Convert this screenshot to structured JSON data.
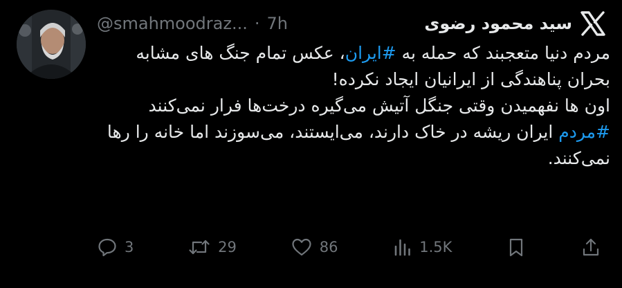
{
  "author": {
    "display_name": "سید محمود رضوی",
    "handle": "@smahmoodraz...",
    "separator": "·",
    "time": "7h"
  },
  "tweet": {
    "line1_pre": "مردم دنیا متعجبند که حمله به ",
    "hashtag1": "#ایران",
    "line1_post": "، عکس تمام جنگ های مشابه بحران پناهندگی از ایرانیان ایجاد نکرده!",
    "para2": "اون ها نفهمیدن وقتی جنگل آتیش می‌گیره درخت‌ها فرار نمی‌کنند",
    "hashtag2": "#مردم",
    "para3_post": " ایران ریشه در خاک دارند، می‌ایستند، می‌سوزند اما خانه را رها نمی‌کنند."
  },
  "actions": {
    "replies": "3",
    "retweets": "29",
    "likes": "86",
    "views": "1.5K"
  },
  "icons": [
    "reply-icon",
    "retweet-icon",
    "like-icon",
    "views-icon",
    "bookmark-icon",
    "share-icon",
    "x-logo-icon"
  ],
  "colors": {
    "background": "#000000",
    "text": "#e7e9ea",
    "muted": "#71767b",
    "hashtag": "#1d9bf0"
  }
}
